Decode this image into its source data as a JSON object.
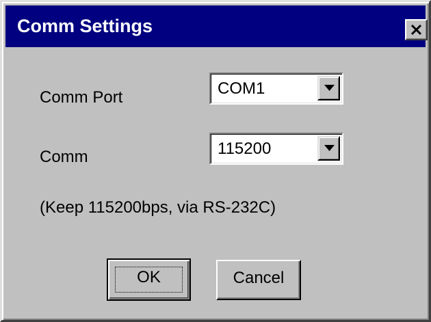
{
  "window": {
    "title": "Comm Settings",
    "close_icon": "close-icon"
  },
  "fields": {
    "comm_port": {
      "label": "Comm Port",
      "value": "COM1",
      "icon": "chevron-down-icon"
    },
    "comm": {
      "label": "Comm",
      "value": "115200",
      "icon": "chevron-down-icon"
    }
  },
  "note": "(Keep 115200bps, via RS-232C)",
  "buttons": {
    "ok": "OK",
    "cancel": "Cancel"
  },
  "colors": {
    "titlebar": "#000080",
    "face": "#c0c0c0",
    "title_text": "#ffffff"
  }
}
